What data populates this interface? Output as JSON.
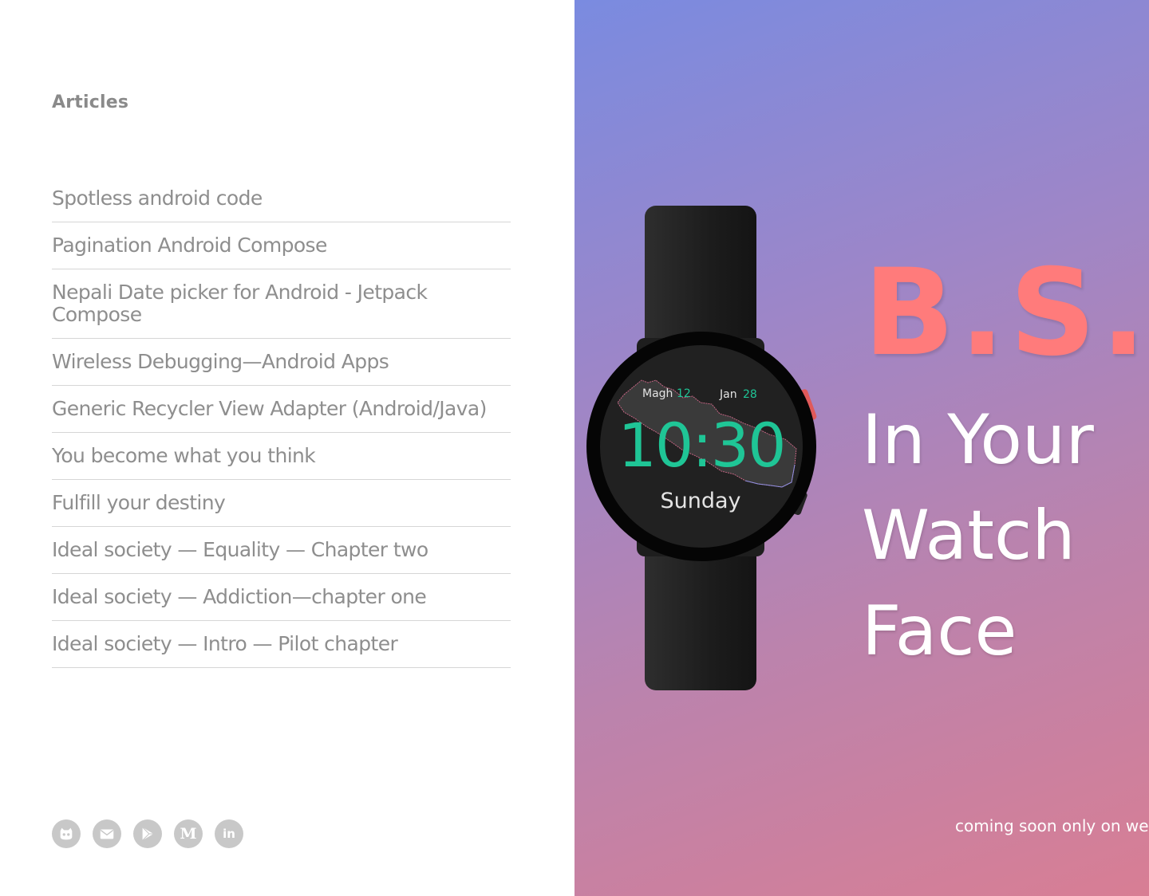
{
  "left": {
    "heading": "Articles",
    "articles": [
      {
        "title": "Spotless android code"
      },
      {
        "title": "Pagination Android Compose"
      },
      {
        "title": "Nepali Date picker for Android - Jetpack Compose"
      },
      {
        "title": "Wireless Debugging—Android Apps"
      },
      {
        "title": "Generic Recycler View Adapter (Android/Java)"
      },
      {
        "title": "You become what you think"
      },
      {
        "title": "Fulfill your destiny"
      },
      {
        "title": "Ideal society — Equality — Chapter two"
      },
      {
        "title": "Ideal society — Addiction—chapter one"
      },
      {
        "title": "Ideal society — Intro — Pilot chapter"
      }
    ],
    "social": [
      {
        "icon": "github-icon"
      },
      {
        "icon": "email-icon"
      },
      {
        "icon": "play-store-icon"
      },
      {
        "icon": "medium-icon",
        "glyph": "M"
      },
      {
        "icon": "linkedin-icon",
        "glyph": "in"
      }
    ]
  },
  "right": {
    "brand": "B.S.",
    "tagline": [
      "In Your",
      "Watch",
      "Face"
    ],
    "footer": "coming soon only on wear",
    "watch": {
      "nepali_month": "Magh",
      "nepali_day": "12",
      "month": "Jan",
      "day": "28",
      "time": "10:30",
      "weekday": "Sunday"
    }
  },
  "colors": {
    "accent_green": "#1fc596",
    "brand_coral": "#ff7b7b",
    "text_gray": "#8e8e8e",
    "icon_gray": "#c8c8c8"
  }
}
